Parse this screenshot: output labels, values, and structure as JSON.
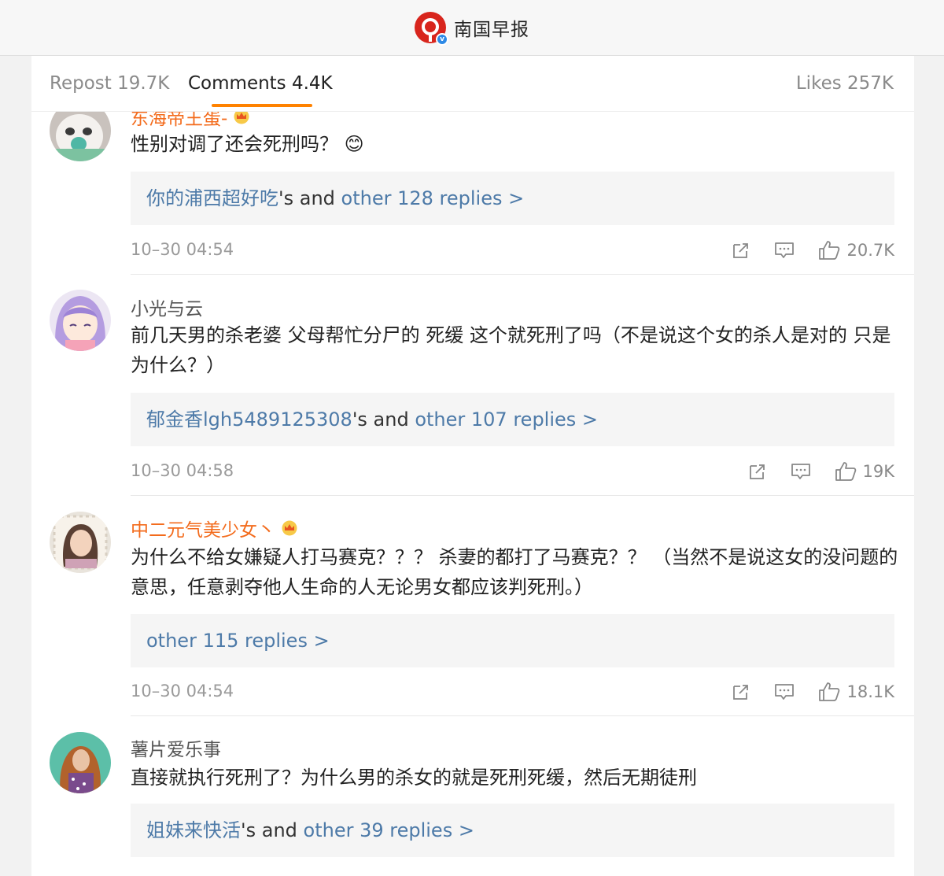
{
  "header": {
    "title": "南国早报",
    "verified_badge": "v"
  },
  "tabs": [
    {
      "label": "Repost 19.7K"
    },
    {
      "label": "Comments 4.4K"
    },
    {
      "label": "Likes 257K"
    }
  ],
  "accent_color": "#ff8200",
  "link_color": "#4d7aa8",
  "comments": [
    {
      "user": "东海帝王蛋-",
      "user_badge": "crown-icon",
      "text": "性别对调了还会死刑吗？",
      "emoji": "😊",
      "reply_user": "你的浦西超好吃",
      "reply_mid": "'s and ",
      "reply_more": "other 128 replies >",
      "time": "10–30 04:54",
      "likes": "20.7K"
    },
    {
      "user": "小光与云",
      "text": "前几天男的杀老婆 父母帮忙分尸的 死缓 这个就死刑了吗（不是说这个女的杀人是对的 只是为什么？）",
      "reply_user": "郁金香lgh5489125308",
      "reply_mid": "'s and ",
      "reply_more": "other 107 replies >",
      "time": "10–30 04:58",
      "likes": "19K"
    },
    {
      "user": "中二元气美少女丶",
      "user_badge": "crown-icon",
      "text": "为什么不给女嫌疑人打马赛克？？？ 杀妻的都打了马赛克？？ （当然不是说这女的没问题的意思，任意剥夺他人生命的人无论男女都应该判死刑。）",
      "reply_more": "other 115 replies >",
      "time": "10–30 04:54",
      "likes": "18.1K"
    },
    {
      "user": "薯片爱乐事",
      "text": "直接就执行死刑了？为什么男的杀女的就是死刑死缓，然后无期徒刑",
      "reply_user": "姐妹来快活",
      "reply_mid": "'s and ",
      "reply_more": "other 39 replies >"
    }
  ]
}
